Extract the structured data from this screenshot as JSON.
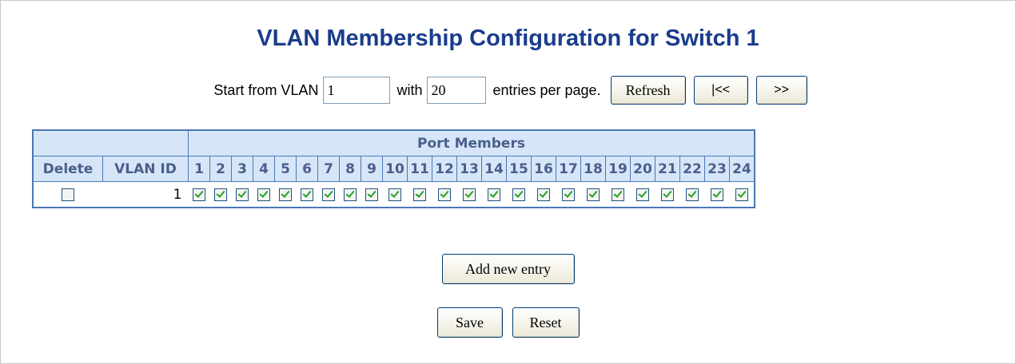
{
  "page": {
    "title": "VLAN Membership Configuration for Switch 1"
  },
  "nav": {
    "start_label": "Start from VLAN",
    "start_value": "1",
    "with_label": "with",
    "entries_value": "20",
    "entries_label": "entries per page.",
    "refresh_label": "Refresh",
    "prev_label": "|<<",
    "next_label": ">>"
  },
  "table": {
    "group_header": "Port Members",
    "delete_header": "Delete",
    "vlan_id_header": "VLAN ID",
    "ports": [
      "1",
      "2",
      "3",
      "4",
      "5",
      "6",
      "7",
      "8",
      "9",
      "10",
      "11",
      "12",
      "13",
      "14",
      "15",
      "16",
      "17",
      "18",
      "19",
      "20",
      "21",
      "22",
      "23",
      "24"
    ],
    "rows": [
      {
        "delete_checked": false,
        "vlan_id": "1",
        "members": [
          true,
          true,
          true,
          true,
          true,
          true,
          true,
          true,
          true,
          true,
          true,
          true,
          true,
          true,
          true,
          true,
          true,
          true,
          true,
          true,
          true,
          true,
          true,
          true
        ]
      }
    ]
  },
  "actions": {
    "add_label": "Add new entry",
    "save_label": "Save",
    "reset_label": "Reset"
  }
}
